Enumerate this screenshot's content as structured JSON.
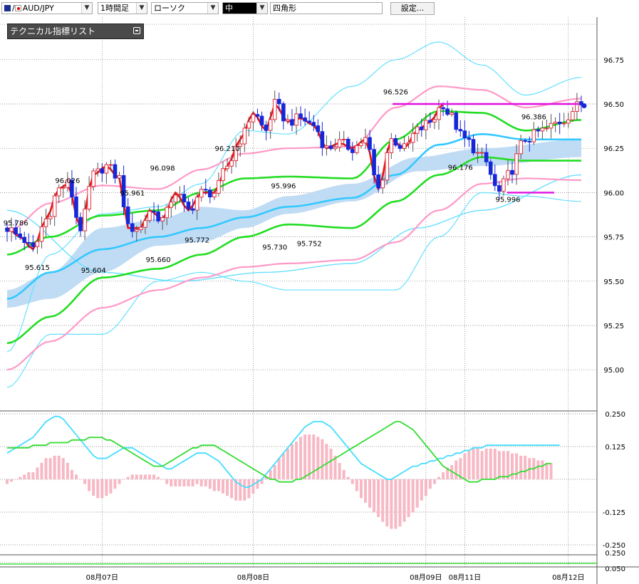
{
  "toolbar": {
    "symbol": "AUD/JPY",
    "timeframe": "1時間足",
    "chart_style": "ローソク",
    "color_select": "中",
    "drawing_tool": "四角形",
    "settings_button": "設定..."
  },
  "indicator_list": {
    "label": "テクニカル指標リスト"
  },
  "colors": {
    "up_candle": "#e03040",
    "down_candle": "#1428d8",
    "red_line": "#ee1111",
    "green_band": "#22dd22",
    "pink_band": "#ff99c8",
    "cyan_band": "#66e0ff",
    "mid_line": "#33c8ff",
    "cloud": "#c0dcf4",
    "magenta": "#e010e0"
  },
  "chart_data": {
    "type": "candlestick",
    "symbol": "AUD/JPY",
    "y_ticks": [
      "96.75",
      "96.50",
      "96.25",
      "96.00",
      "95.75",
      "95.50",
      "95.25",
      "95.00"
    ],
    "ylim": [
      94.9,
      96.95
    ],
    "x_labels": [
      "08月07日",
      "08月08日",
      "08月09日",
      "08月11日",
      "08月12日"
    ],
    "x_label_index": [
      22,
      57,
      97,
      106,
      130
    ],
    "annotations": [
      {
        "text": "95.786",
        "index": 2,
        "value": 95.79,
        "pos": "above"
      },
      {
        "text": "95.615",
        "index": 7,
        "value": 95.615,
        "pos": "below"
      },
      {
        "text": "96.026",
        "index": 14,
        "value": 96.03,
        "pos": "above"
      },
      {
        "text": "95.604",
        "index": 20,
        "value": 95.6,
        "pos": "below"
      },
      {
        "text": "95.961",
        "index": 29,
        "value": 95.96,
        "pos": "above"
      },
      {
        "text": "96.098",
        "index": 36,
        "value": 96.1,
        "pos": "above"
      },
      {
        "text": "95.660",
        "index": 35,
        "value": 95.66,
        "pos": "below"
      },
      {
        "text": "95.772",
        "index": 44,
        "value": 95.77,
        "pos": "below"
      },
      {
        "text": "96.210",
        "index": 51,
        "value": 96.21,
        "pos": "above"
      },
      {
        "text": "95.996",
        "index": 64,
        "value": 96.0,
        "pos": "above"
      },
      {
        "text": "95.730",
        "index": 62,
        "value": 95.73,
        "pos": "below"
      },
      {
        "text": "95.752",
        "index": 70,
        "value": 95.75,
        "pos": "below"
      },
      {
        "text": "96.526",
        "index": 90,
        "value": 96.53,
        "pos": "above"
      },
      {
        "text": "96.176",
        "index": 105,
        "value": 96.18,
        "pos": "below"
      },
      {
        "text": "96.386",
        "index": 122,
        "value": 96.39,
        "pos": "above"
      },
      {
        "text": "95.996",
        "index": 116,
        "value": 96.0,
        "pos": "below"
      }
    ],
    "macd": {
      "y_ticks": [
        "0.250",
        "0.125",
        "-0.125",
        "-0.250"
      ],
      "ylim": [
        -0.32,
        0.32
      ],
      "signal": [
        0.12,
        0.12,
        0.12,
        0.12,
        0.12,
        0.12,
        0.13,
        0.13,
        0.13,
        0.13,
        0.14,
        0.14,
        0.14,
        0.14,
        0.14,
        0.15,
        0.15,
        0.15,
        0.15,
        0.16,
        0.16,
        0.16,
        0.16,
        0.15,
        0.15,
        0.14,
        0.13,
        0.12,
        0.11,
        0.1,
        0.09,
        0.08,
        0.07,
        0.06,
        0.05,
        0.05,
        0.05,
        0.06,
        0.07,
        0.08,
        0.09,
        0.1,
        0.11,
        0.12,
        0.12,
        0.13,
        0.13,
        0.13,
        0.13,
        0.12,
        0.11,
        0.1,
        0.09,
        0.08,
        0.07,
        0.06,
        0.05,
        0.04,
        0.03,
        0.02,
        0.01,
        0.0,
        0.0,
        -0.01,
        -0.01,
        -0.01,
        -0.01,
        0.0,
        0.0,
        0.01,
        0.02,
        0.03,
        0.04,
        0.05,
        0.06,
        0.07,
        0.08,
        0.09,
        0.1,
        0.11,
        0.12,
        0.13,
        0.14,
        0.15,
        0.16,
        0.17,
        0.18,
        0.19,
        0.2,
        0.21,
        0.22,
        0.22,
        0.21,
        0.2,
        0.19,
        0.17,
        0.15,
        0.13,
        0.11,
        0.09,
        0.07,
        0.05,
        0.04,
        0.03,
        0.02,
        0.01,
        0.0,
        -0.01,
        -0.01,
        -0.01,
        0.0,
        0.0,
        0.0,
        0.0,
        0.01,
        0.01,
        0.01,
        0.02,
        0.02,
        0.03,
        0.03,
        0.04,
        0.04,
        0.05,
        0.05,
        0.06,
        0.06
      ],
      "macd_line": [
        0.1,
        0.11,
        0.12,
        0.13,
        0.14,
        0.15,
        0.16,
        0.18,
        0.2,
        0.22,
        0.23,
        0.24,
        0.24,
        0.23,
        0.21,
        0.19,
        0.17,
        0.15,
        0.13,
        0.11,
        0.09,
        0.08,
        0.08,
        0.08,
        0.09,
        0.1,
        0.11,
        0.12,
        0.12,
        0.12,
        0.11,
        0.1,
        0.09,
        0.08,
        0.07,
        0.06,
        0.05,
        0.04,
        0.04,
        0.05,
        0.06,
        0.07,
        0.08,
        0.09,
        0.1,
        0.1,
        0.1,
        0.09,
        0.08,
        0.07,
        0.05,
        0.03,
        0.01,
        -0.01,
        -0.02,
        -0.03,
        -0.03,
        -0.02,
        -0.01,
        0.0,
        0.02,
        0.04,
        0.06,
        0.08,
        0.1,
        0.12,
        0.14,
        0.16,
        0.18,
        0.2,
        0.21,
        0.22,
        0.22,
        0.22,
        0.21,
        0.2,
        0.18,
        0.16,
        0.14,
        0.12,
        0.1,
        0.08,
        0.06,
        0.05,
        0.04,
        0.03,
        0.02,
        0.01,
        0.0,
        0.0,
        0.01,
        0.02,
        0.03,
        0.04,
        0.05,
        0.05,
        0.06,
        0.06,
        0.07,
        0.07,
        0.08,
        0.08,
        0.09,
        0.09,
        0.1,
        0.1,
        0.11,
        0.11,
        0.12,
        0.12,
        0.12,
        0.13,
        0.13,
        0.13,
        0.13,
        0.13,
        0.13,
        0.13,
        0.13,
        0.13,
        0.13,
        0.13,
        0.13,
        0.13,
        0.13,
        0.13,
        0.13,
        0.13,
        0.13
      ]
    }
  }
}
